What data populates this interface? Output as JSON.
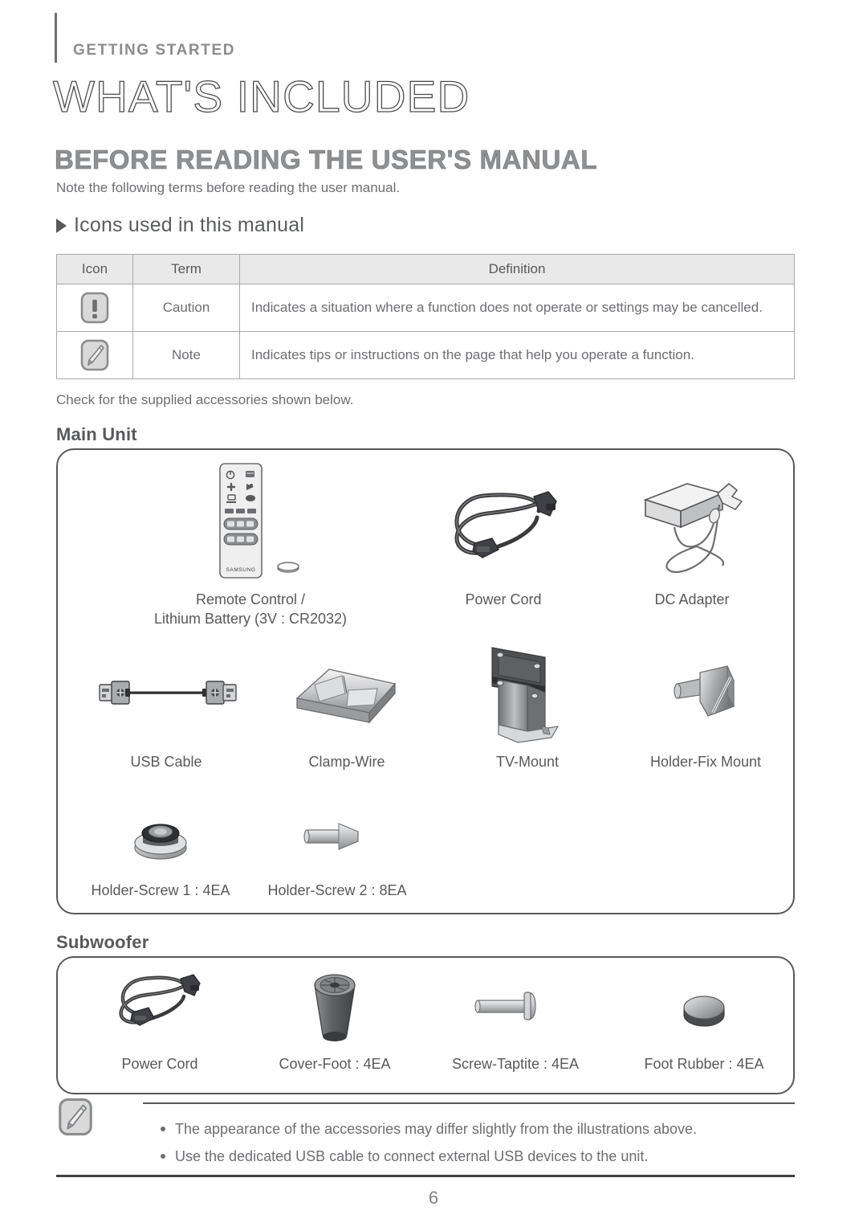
{
  "header": {
    "running_head": "GETTING STARTED",
    "chapter_title": "WHAT'S INCLUDED",
    "section_title": "BEFORE READING THE USER'S MANUAL",
    "section_intro": "Note the following terms before reading the user manual.",
    "subsection_label": "Icons used in this manual",
    "triangle_icon": "triangle-right-icon"
  },
  "icons_table": {
    "columns": [
      "Icon",
      "Term",
      "Definition"
    ],
    "rows": [
      {
        "icon": "caution-exclamation-icon",
        "term": "Caution",
        "definition": "Indicates a situation where a function does not operate or settings may be cancelled."
      },
      {
        "icon": "note-pencil-icon",
        "term": "Note",
        "definition": "Indicates tips or instructions on the page that help you operate a function."
      }
    ]
  },
  "after_table_note": "Check for the supplied accessories shown below.",
  "main_unit": {
    "heading": "Main Unit",
    "accessories": [
      {
        "label": "Remote Control /\nLithium Battery (3V : CR2032)",
        "art": "remote-control-and-battery-art"
      },
      {
        "label": "Power Cord",
        "art": "power-cord-art"
      },
      {
        "label": "DC Adapter",
        "art": "dc-adapter-art"
      },
      {
        "label": "USB Cable",
        "art": "usb-cable-art"
      },
      {
        "label": "Clamp-Wire",
        "art": "clamp-wire-art"
      },
      {
        "label": "TV-Mount",
        "art": "tv-mount-art"
      },
      {
        "label": "Holder-Fix Mount",
        "art": "holder-fix-mount-art"
      },
      {
        "label": "Holder-Screw 1 : 4EA",
        "art": "holder-screw-1-art"
      },
      {
        "label": "Holder-Screw 2 : 8EA",
        "art": "holder-screw-2-art"
      }
    ]
  },
  "subwoofer": {
    "heading": "Subwoofer",
    "accessories": [
      {
        "label": "Power Cord",
        "art": "subwoofer-power-cord-art"
      },
      {
        "label": "Cover-Foot : 4EA",
        "art": "cover-foot-art"
      },
      {
        "label": "Screw-Taptite : 4EA",
        "art": "screw-taptite-art"
      },
      {
        "label": "Foot Rubber : 4EA",
        "art": "foot-rubber-art"
      }
    ]
  },
  "bottom_note": {
    "icon": "note-pencil-icon",
    "items": [
      "The appearance of the accessories may differ slightly from the illustrations above.",
      "Use the dedicated USB cable to connect external USB devices to the unit."
    ]
  },
  "footer": {
    "page_number": "6"
  },
  "colors": {
    "text_gray": "#6d6e71",
    "dark_gray": "#58595b",
    "table_header_bg": "#e9e9e9",
    "border_gray": "#a7a9ac"
  }
}
